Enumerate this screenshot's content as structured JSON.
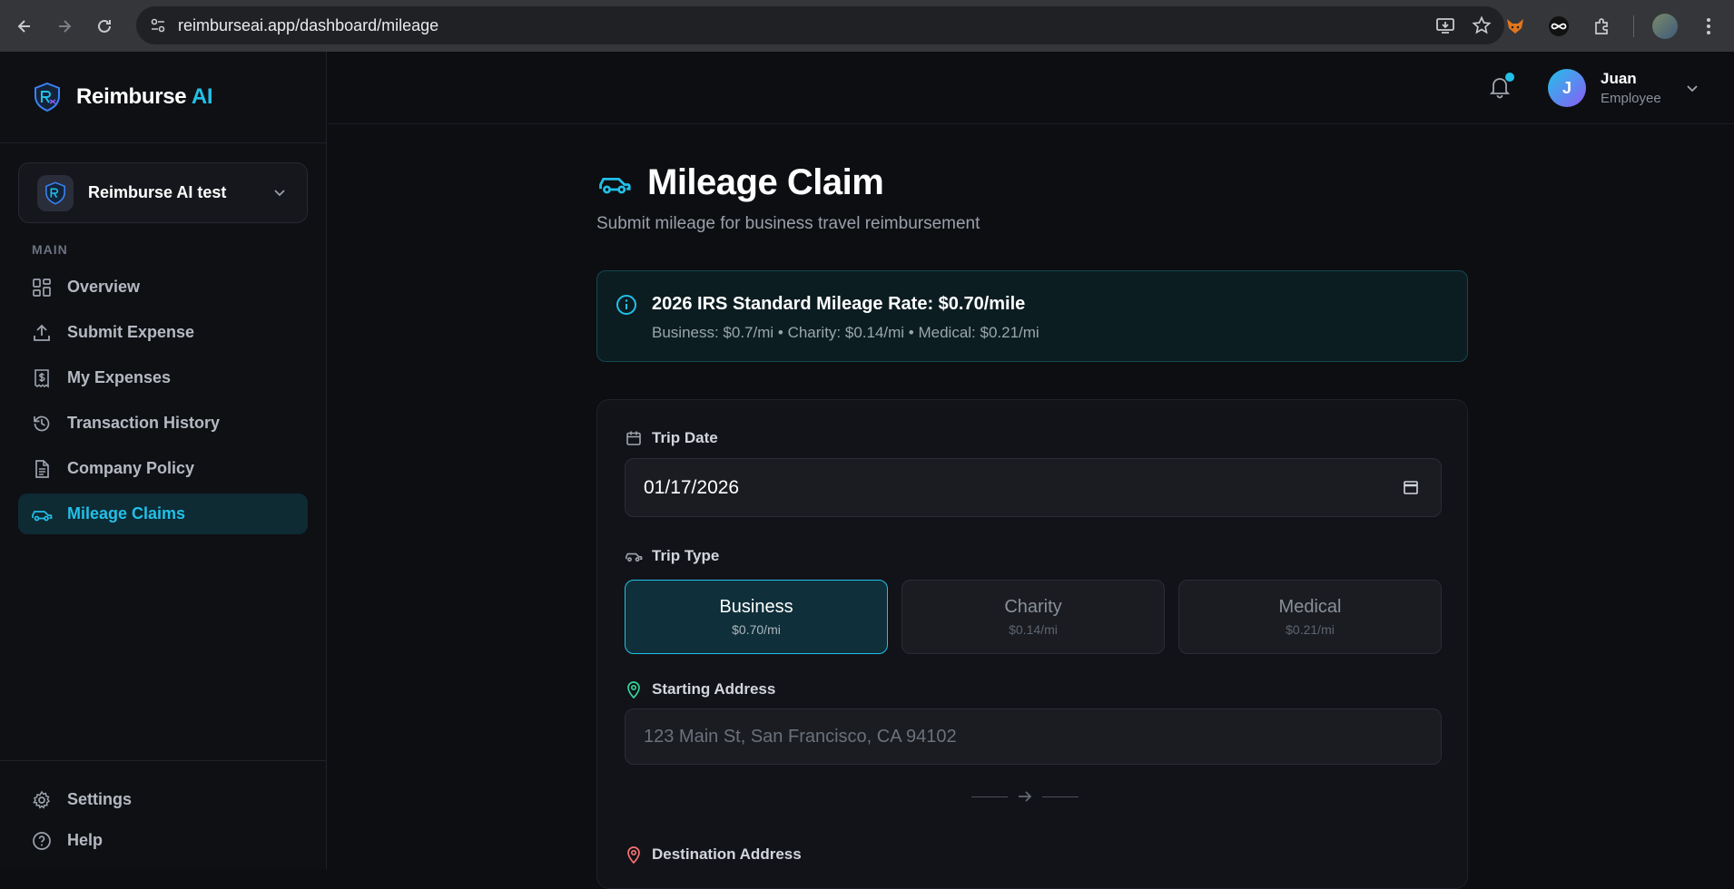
{
  "browser": {
    "url": "reimburseai.app/dashboard/mileage"
  },
  "sidebar": {
    "brand_main": "Reimburse ",
    "brand_accent": "AI",
    "org_name": "Reimburse AI test",
    "section_label": "MAIN",
    "items": [
      {
        "label": "Overview",
        "icon": "grid-icon"
      },
      {
        "label": "Submit Expense",
        "icon": "upload-icon"
      },
      {
        "label": "My Expenses",
        "icon": "receipt-icon"
      },
      {
        "label": "Transaction History",
        "icon": "history-icon"
      },
      {
        "label": "Company Policy",
        "icon": "document-icon"
      },
      {
        "label": "Mileage Claims",
        "icon": "car-icon",
        "active": true
      }
    ],
    "bottom_items": [
      {
        "label": "Settings",
        "icon": "gear-icon"
      },
      {
        "label": "Help",
        "icon": "help-icon"
      }
    ]
  },
  "topbar": {
    "user_initial": "J",
    "user_name": "Juan",
    "user_role": "Employee"
  },
  "main": {
    "title": "Mileage Claim",
    "subtitle": "Submit mileage for business travel reimbursement",
    "info": {
      "title": "2026 IRS Standard Mileage Rate: $0.70/mile",
      "detail": "Business: $0.7/mi • Charity: $0.14/mi • Medical: $0.21/mi"
    },
    "form": {
      "trip_date_label": "Trip Date",
      "trip_date_value": "01/17/2026",
      "trip_type_label": "Trip Type",
      "trip_types": [
        {
          "name": "Business",
          "rate": "$0.70/mi",
          "selected": true
        },
        {
          "name": "Charity",
          "rate": "$0.14/mi",
          "selected": false
        },
        {
          "name": "Medical",
          "rate": "$0.21/mi",
          "selected": false
        }
      ],
      "start_label": "Starting Address",
      "start_placeholder": "123 Main St, San Francisco, CA 94102",
      "dest_label": "Destination Address"
    }
  },
  "colors": {
    "accent": "#22c0e8",
    "background": "#0d0e12",
    "start_pin": "#34d399",
    "dest_pin": "#f87171"
  }
}
